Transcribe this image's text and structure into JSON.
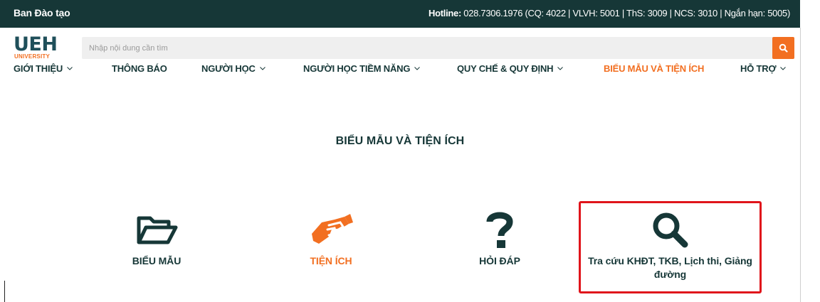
{
  "topbar": {
    "unit_name": "Ban Đào tạo",
    "hotline_label": "Hotline:",
    "hotline_value": " 028.7306.1976 (CQ: 4022 | VLVH: 5001 | ThS: 3009 | NCS: 3010 | Ngắn hạn: 5005)"
  },
  "logo": {
    "main": "UEH",
    "sub": "UNIVERSITY"
  },
  "search": {
    "placeholder": "Nhập nội dung cần tìm",
    "value": ""
  },
  "nav": {
    "items": [
      {
        "label": "GIỚI THIỆU",
        "dropdown": true
      },
      {
        "label": "THÔNG BÁO",
        "dropdown": false
      },
      {
        "label": "NGƯỜI HỌC",
        "dropdown": true
      },
      {
        "label": "NGƯỜI HỌC TIỀM NĂNG",
        "dropdown": true
      },
      {
        "label": "QUY CHẾ & QUY ĐỊNH",
        "dropdown": true
      },
      {
        "label": "BIỂU MẪU VÀ TIỆN ÍCH",
        "dropdown": false,
        "active": true
      },
      {
        "label": "HỖ TRỢ",
        "dropdown": true
      }
    ]
  },
  "main": {
    "title": "BIỂU MẪU VÀ TIỆN ÍCH",
    "cards": [
      {
        "label": "BIỂU MẪU",
        "icon": "folder-open-icon"
      },
      {
        "label": "TIỆN ÍCH",
        "icon": "handshake-icon"
      },
      {
        "label": "HỎI ĐÁP",
        "icon": "question-icon"
      },
      {
        "label": "Tra cứu KHĐT, TKB, Lịch thi, Giảng đường",
        "icon": "search-icon",
        "highlighted": true
      }
    ]
  },
  "colors": {
    "dark": "#163737",
    "accent": "#f26f21",
    "highlight_border": "#e0141b"
  }
}
